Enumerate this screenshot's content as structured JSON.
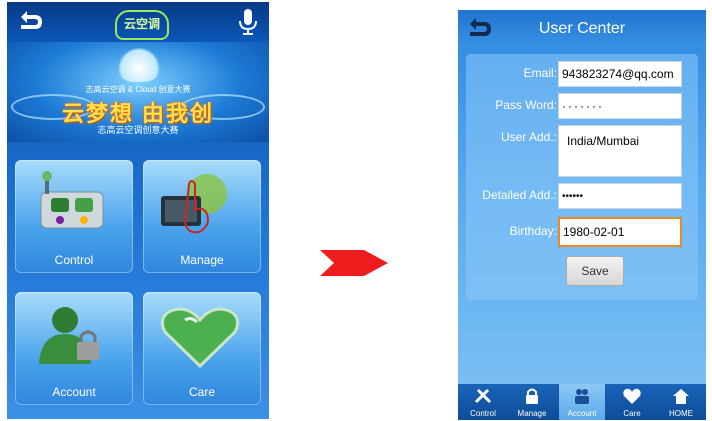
{
  "left_screen": {
    "banner": {
      "title": "云梦想 由我创",
      "subtitle": "志高云空调 & Cloud 创意大赛",
      "caption": "志高云空调创意大赛"
    },
    "logo_text": "云空调",
    "tiles": [
      {
        "label": "Control"
      },
      {
        "label": "Manage"
      },
      {
        "label": "Account"
      },
      {
        "label": "Care"
      }
    ]
  },
  "right_screen": {
    "title": "User Center",
    "form": {
      "email_label": "Email:",
      "email_value": "943823274@qq.com",
      "password_label": "Pass Word:",
      "password_value": "·······",
      "user_add_label": "User Add.:",
      "user_add_value": "India/Mumbai",
      "detailed_add_label": "Detailed Add.:",
      "detailed_add_value": "••••••",
      "birthday_label": "Birthday:",
      "birthday_value": "1980-02-01",
      "save_label": "Save"
    },
    "nav": [
      {
        "label": "Control",
        "icon": "tools-icon"
      },
      {
        "label": "Manage",
        "icon": "lock-icon"
      },
      {
        "label": "Account",
        "icon": "people-icon"
      },
      {
        "label": "Care",
        "icon": "heart-icon"
      },
      {
        "label": "HOME",
        "icon": "home-icon"
      }
    ]
  },
  "colors": {
    "accent_orange": "#e88a2a",
    "arrow_red": "#ee1c1c"
  }
}
